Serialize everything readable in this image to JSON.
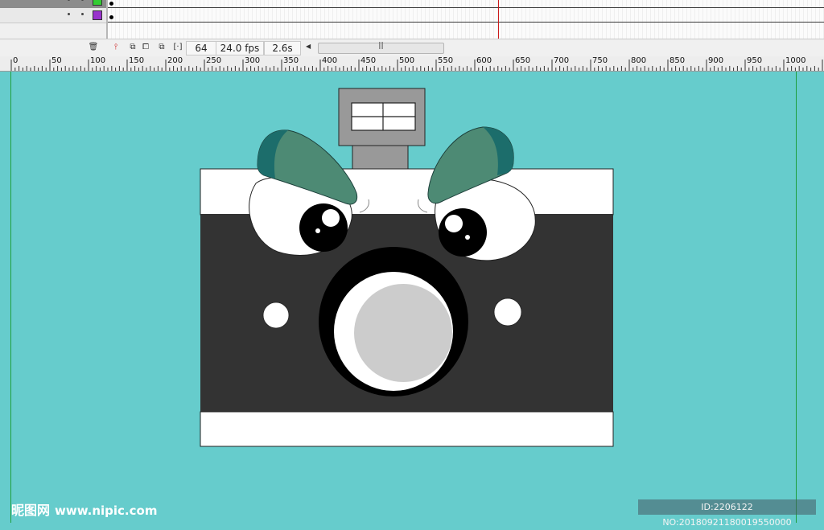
{
  "timeline": {
    "layers": [
      {
        "swatch_color": "#33cc33"
      },
      {
        "swatch_color": "#9933cc"
      },
      {}
    ],
    "current_frame": "64",
    "frame_rate": "24.0 fps",
    "elapsed_time": "2.6s",
    "buttons": [
      "trash-icon",
      "center-frame-icon",
      "onion-skin-icon",
      "onion-skin-outlines-icon",
      "edit-multiple-frames-icon",
      "modify-onion-markers-icon"
    ]
  },
  "ruler": {
    "labels": [
      "0",
      "50",
      "100",
      "150",
      "200",
      "250",
      "300",
      "350",
      "400",
      "450",
      "500",
      "550",
      "600",
      "650",
      "700",
      "750",
      "800",
      "850",
      "900",
      "950",
      "1000"
    ]
  },
  "colors": {
    "stage_bg": "#66cccc",
    "camera_body": "#333333",
    "camera_band": "#ffffff",
    "eyebrow": "#4d8a74",
    "eyebrow_dark": "#1c6d6b",
    "viewfinder": "#999999",
    "lens_inner": "#cccccc"
  },
  "watermark": {
    "site_cn": "昵图网",
    "site_url": "www.nipic.com",
    "id_text": "ID:2206122 NO:20180921180019550000"
  }
}
